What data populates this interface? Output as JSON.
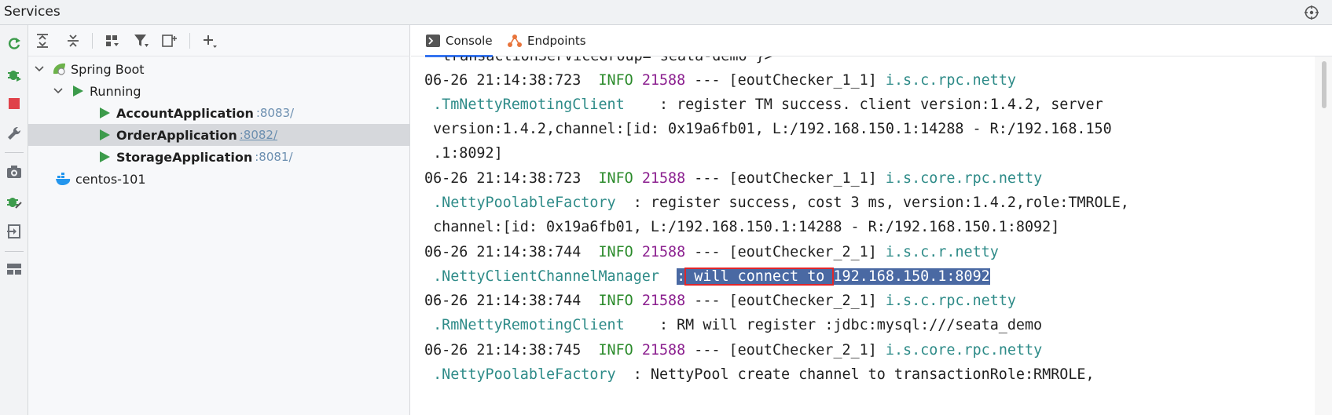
{
  "window": {
    "title": "Services",
    "gear_icon": "crosshair-gear-icon"
  },
  "leftbar": {
    "icons": [
      "rerun-icon",
      "debug-bug-icon",
      "stop-icon",
      "wrench-icon",
      "camera-icon",
      "pin-bug-icon",
      "exit-icon",
      "layout-icon"
    ]
  },
  "tree_toolbar": {
    "icons": [
      "expand-all-icon",
      "collapse-all-icon",
      "group-icon",
      "filter-icon",
      "new-service-icon",
      "add-icon"
    ]
  },
  "tree": {
    "spring_boot": "Spring Boot",
    "running": "Running",
    "apps": [
      {
        "name": "AccountApplication",
        "port": ":8083/"
      },
      {
        "name": "OrderApplication",
        "port": ":8082/"
      },
      {
        "name": "StorageApplication",
        "port": ":8081/"
      }
    ],
    "docker": "centos-101"
  },
  "tabs": {
    "console": "Console",
    "endpoints": "Endpoints"
  },
  "console": {
    "top_partial": "transactionServiceGroup='seata-demo'}>",
    "entries": [
      {
        "ts": "06-26 21:14:38:723",
        "level": "INFO",
        "pid": "21588",
        "thread": "--- [eoutChecker_1_1]",
        "logger1": "i.s.c.rpc.netty",
        "logger2": ".TmNettyRemotingClient",
        "msg1": "    : register TM success. client version:1.4.2, server",
        "msg2": " version:1.4.2,channel:[id: 0x19a6fb01, L:/192.168.150.1:14288 - R:/192.168.150",
        "msg3": " .1:8092]"
      },
      {
        "ts": "06-26 21:14:38:723",
        "level": "INFO",
        "pid": "21588",
        "thread": "--- [eoutChecker_1_1]",
        "logger1": "i.s.core.rpc.netty",
        "logger2": ".NettyPoolableFactory",
        "msg1": "  : register success, cost 3 ms, version:1.4.2,role:TMROLE,",
        "msg2": " channel:[id: 0x19a6fb01, L:/192.168.150.1:14288 - R:/192.168.150.1:8092]"
      },
      {
        "ts": "06-26 21:14:38:744",
        "level": "INFO",
        "pid": "21588",
        "thread": "--- [eoutChecker_2_1]",
        "logger1": "i.s.c.r.netty",
        "logger2": ".NettyClientChannelManager",
        "sel_colon": ":",
        "sel_box": " will connect to ",
        "sel_addr": "192.168.150.1:8092"
      },
      {
        "ts": "06-26 21:14:38:744",
        "level": "INFO",
        "pid": "21588",
        "thread": "--- [eoutChecker_2_1]",
        "logger1": "i.s.c.rpc.netty",
        "logger2": ".RmNettyRemotingClient",
        "msg1": "    : RM will register :jdbc:mysql:///seata_demo"
      },
      {
        "ts": "06-26 21:14:38:745",
        "level": "INFO",
        "pid": "21588",
        "thread": "--- [eoutChecker_2_1]",
        "logger1": "i.s.core.rpc.netty",
        "logger2": ".NettyPoolableFactory",
        "msg1": "  : NettyPool create channel to transactionRole:RMROLE,"
      }
    ]
  },
  "colors": {
    "info": "#2a8a2a",
    "pid": "#8b1f8f",
    "logger": "#2e8b88",
    "selection": "#4a69a3",
    "highlight_box": "#e0262a",
    "port_link": "#6c8fb0"
  }
}
